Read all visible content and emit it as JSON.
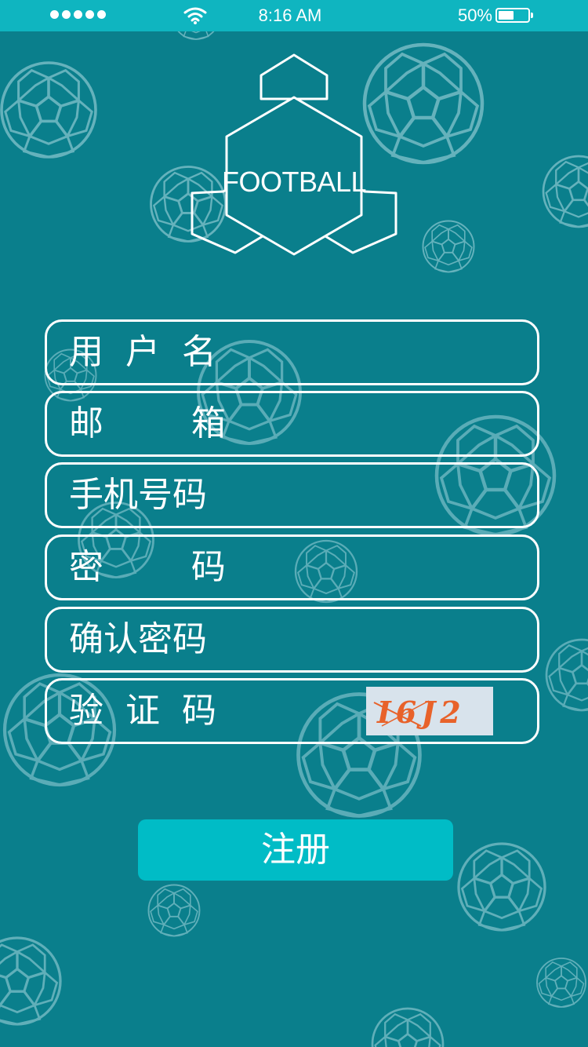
{
  "status_bar": {
    "time": "8:16 AM",
    "battery_percent_label": "50%",
    "battery_level": 0.5,
    "signal_icon": "signal-dots-icon",
    "wifi_icon": "wifi-icon"
  },
  "logo": {
    "text": "FOOTBALL",
    "icon": "hexagon-logo-icon"
  },
  "form": {
    "fields": [
      {
        "label": "用  户  名"
      },
      {
        "label": "邮        箱"
      },
      {
        "label": "手机号码"
      },
      {
        "label": "密        码"
      },
      {
        "label": "确认密码"
      },
      {
        "label": "验  证  码"
      }
    ],
    "captcha_text": "I6J2"
  },
  "register_button": {
    "label": "注册"
  },
  "colors": {
    "background": "#0a7f8c",
    "status_bar": "#0fb5c0",
    "button": "#00bcc6",
    "captcha_bg": "#d8e3ec",
    "captcha_text": "#e8622a",
    "ball_stroke": "#6fb8c2"
  }
}
